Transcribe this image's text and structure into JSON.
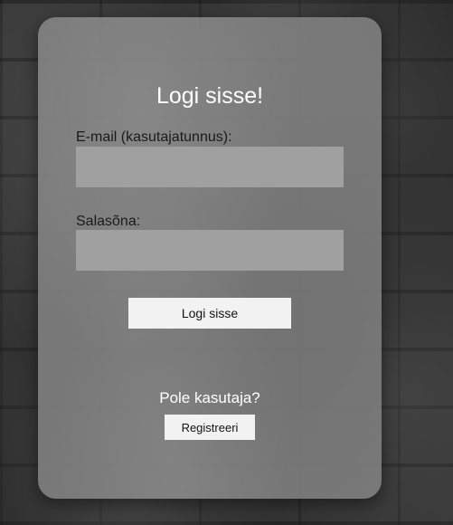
{
  "login_form": {
    "title": "Logi sisse!",
    "email_label": "E-mail (kasutajatunnus):",
    "email_value": "",
    "password_label": "Salasõna:",
    "password_value": "",
    "login_button": "Logi sisse"
  },
  "register": {
    "prompt": "Pole kasutaja?",
    "button": "Registreeri"
  },
  "colors": {
    "card": "#828282",
    "input": "#a0a0a0",
    "button": "#f2f2f2",
    "title_text": "#ffffff"
  }
}
